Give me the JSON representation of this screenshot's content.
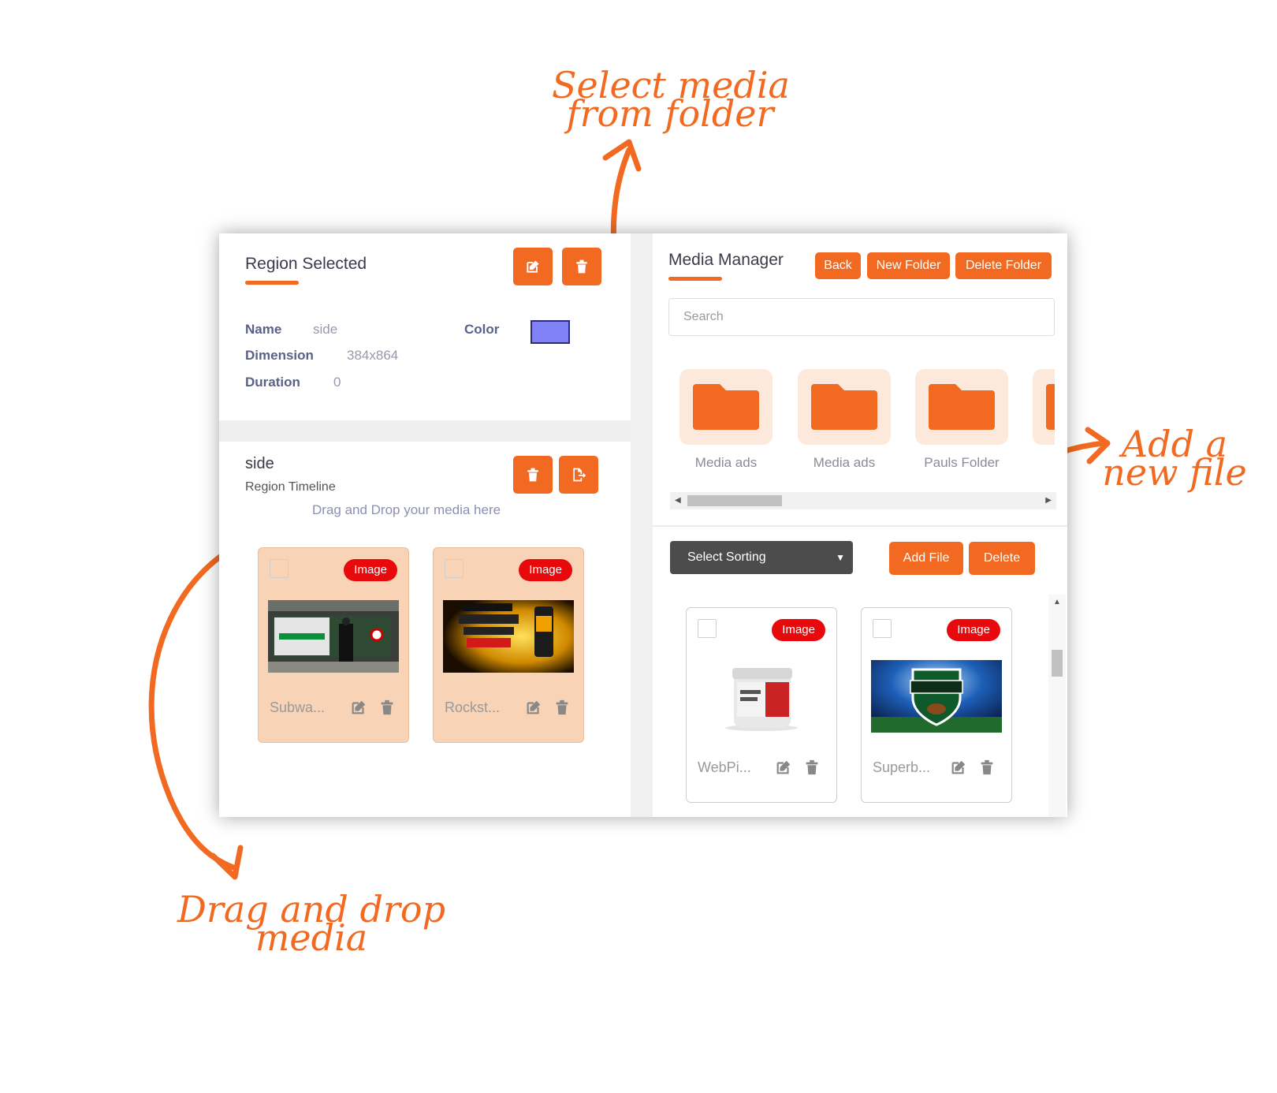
{
  "annotations": {
    "select_media": "Select media\nfrom folder",
    "add_file": "Add a\nnew file",
    "drag_drop": "Drag and drop\nmedia"
  },
  "region": {
    "title": "Region Selected",
    "name_label": "Name",
    "name_value": "side",
    "color_label": "Color",
    "color_value": "#8182f5",
    "dimension_label": "Dimension",
    "dimension_value": "384x864",
    "duration_label": "Duration",
    "duration_value": "0"
  },
  "timeline": {
    "title": "side",
    "subtitle": "Region Timeline",
    "drop_hint": "Drag and Drop your media here",
    "items": [
      {
        "name": "Subwa...",
        "badge": "Image"
      },
      {
        "name": "Rockst...",
        "badge": "Image"
      }
    ]
  },
  "media_manager": {
    "title": "Media Manager",
    "back_label": "Back",
    "new_folder_label": "New Folder",
    "delete_folder_label": "Delete Folder",
    "search_placeholder": "Search",
    "folders": [
      "Media ads",
      "Media ads",
      "Pauls Folder"
    ],
    "sorting_label": "Select Sorting",
    "add_file_label": "Add File",
    "delete_label": "Delete",
    "files": [
      {
        "name": "WebPi...",
        "badge": "Image"
      },
      {
        "name": "Superb...",
        "badge": "Image"
      }
    ]
  },
  "colors": {
    "accent": "#f26a21",
    "badge": "#e8090c",
    "timeline_card": "#f8d3b5"
  }
}
